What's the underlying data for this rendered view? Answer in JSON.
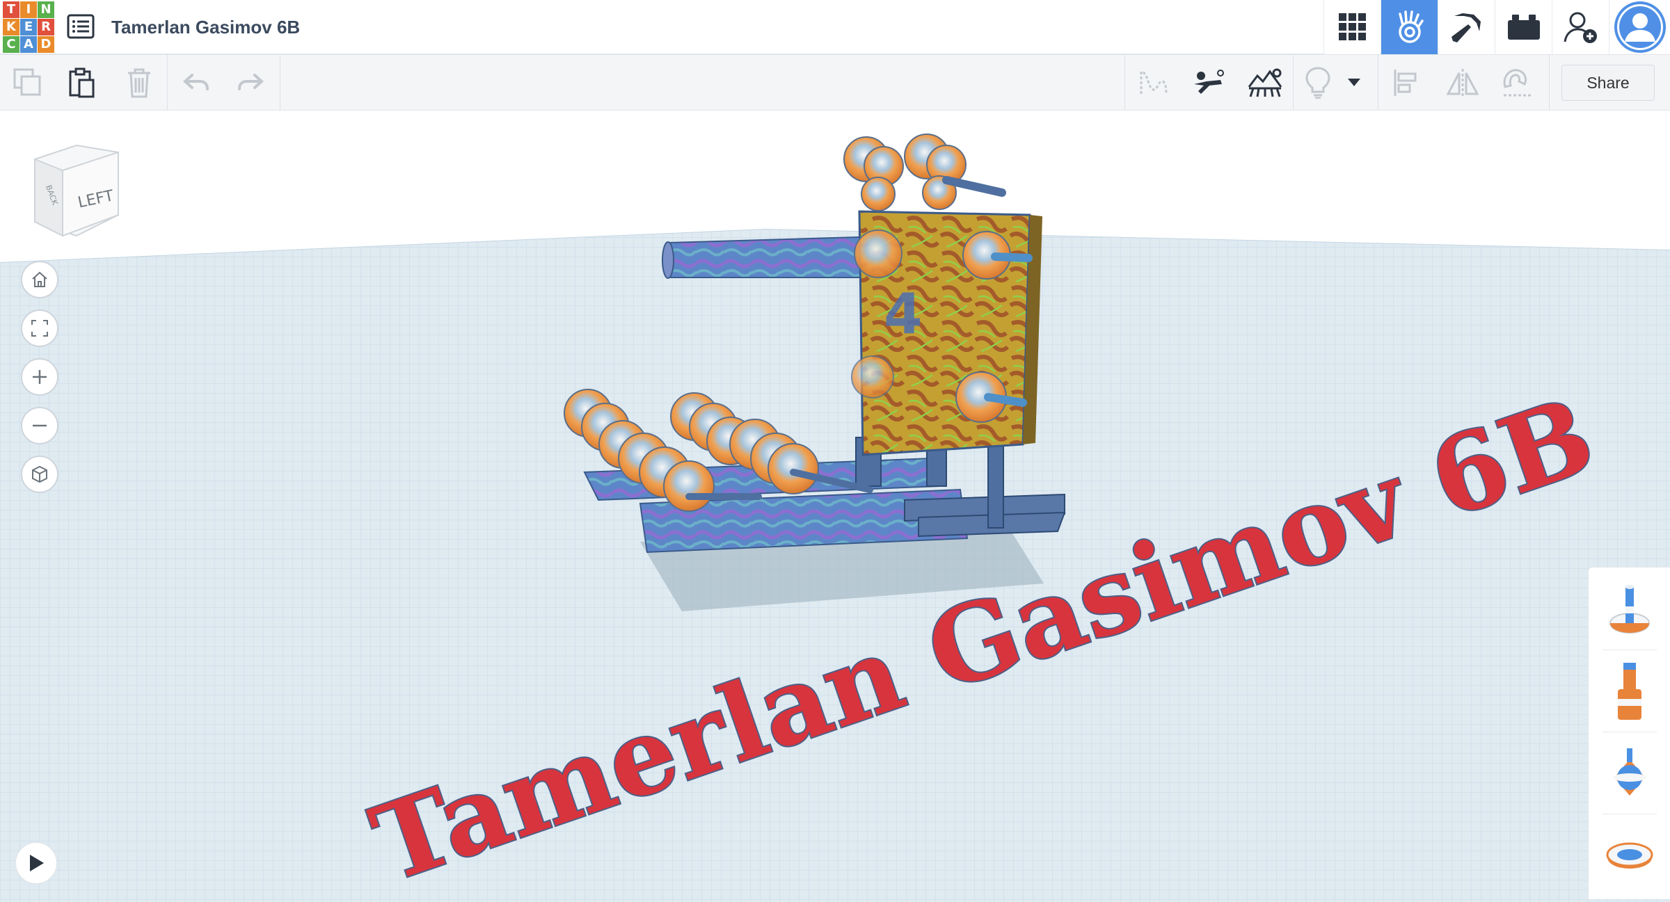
{
  "app": {
    "logo_letters": [
      "T",
      "I",
      "N",
      "K",
      "E",
      "R",
      "C",
      "A",
      "D"
    ],
    "logo_colors": [
      "#e0503c",
      "#e98b2a",
      "#59b04d",
      "#e98b2a",
      "#4f8fd6",
      "#e0503c",
      "#59b04d",
      "#4f8fd6",
      "#e98b2a"
    ],
    "document_title": "Tamerlan Gasimov 6B",
    "accent_color": "#4f90e6"
  },
  "header": {
    "design_list_icon": "list-icon",
    "buttons": [
      {
        "id": "gallery",
        "icon": "grid-icon",
        "active": false
      },
      {
        "id": "3d-design",
        "icon": "hand-icon",
        "active": true
      },
      {
        "id": "minecraft",
        "icon": "pickaxe-icon",
        "active": false
      },
      {
        "id": "lego-bricks",
        "icon": "brick-icon",
        "active": false
      },
      {
        "id": "invite",
        "icon": "add-user-icon",
        "active": false
      },
      {
        "id": "profile",
        "icon": "avatar-icon",
        "active": false
      }
    ]
  },
  "toolbar": {
    "left_tools": [
      "copy-icon",
      "paste-icon",
      "delete-icon",
      "undo-icon",
      "redo-icon"
    ],
    "right_tools": [
      "notes-icon",
      "visibility-icon",
      "import-icon",
      "light-icon",
      "dropdown-icon",
      "align-icon",
      "mirror-icon",
      "magnet-icon"
    ],
    "share_label": "Share"
  },
  "viewcube": {
    "face_label": "LEFT",
    "side_label": "BACK"
  },
  "nav_controls": [
    "home-icon",
    "fit-icon",
    "zoom-in-icon",
    "zoom-out-icon",
    "ortho-icon"
  ],
  "scene": {
    "text_object": "Tamerlan Gasimov 6B",
    "panel_number": "4",
    "text_color": "#d8343d",
    "grid_color": "#dce9f0"
  },
  "shape_panel": [
    "shape-tall-icon",
    "shape-bottle-icon",
    "shape-spinner-icon",
    "shape-ring-icon"
  ]
}
